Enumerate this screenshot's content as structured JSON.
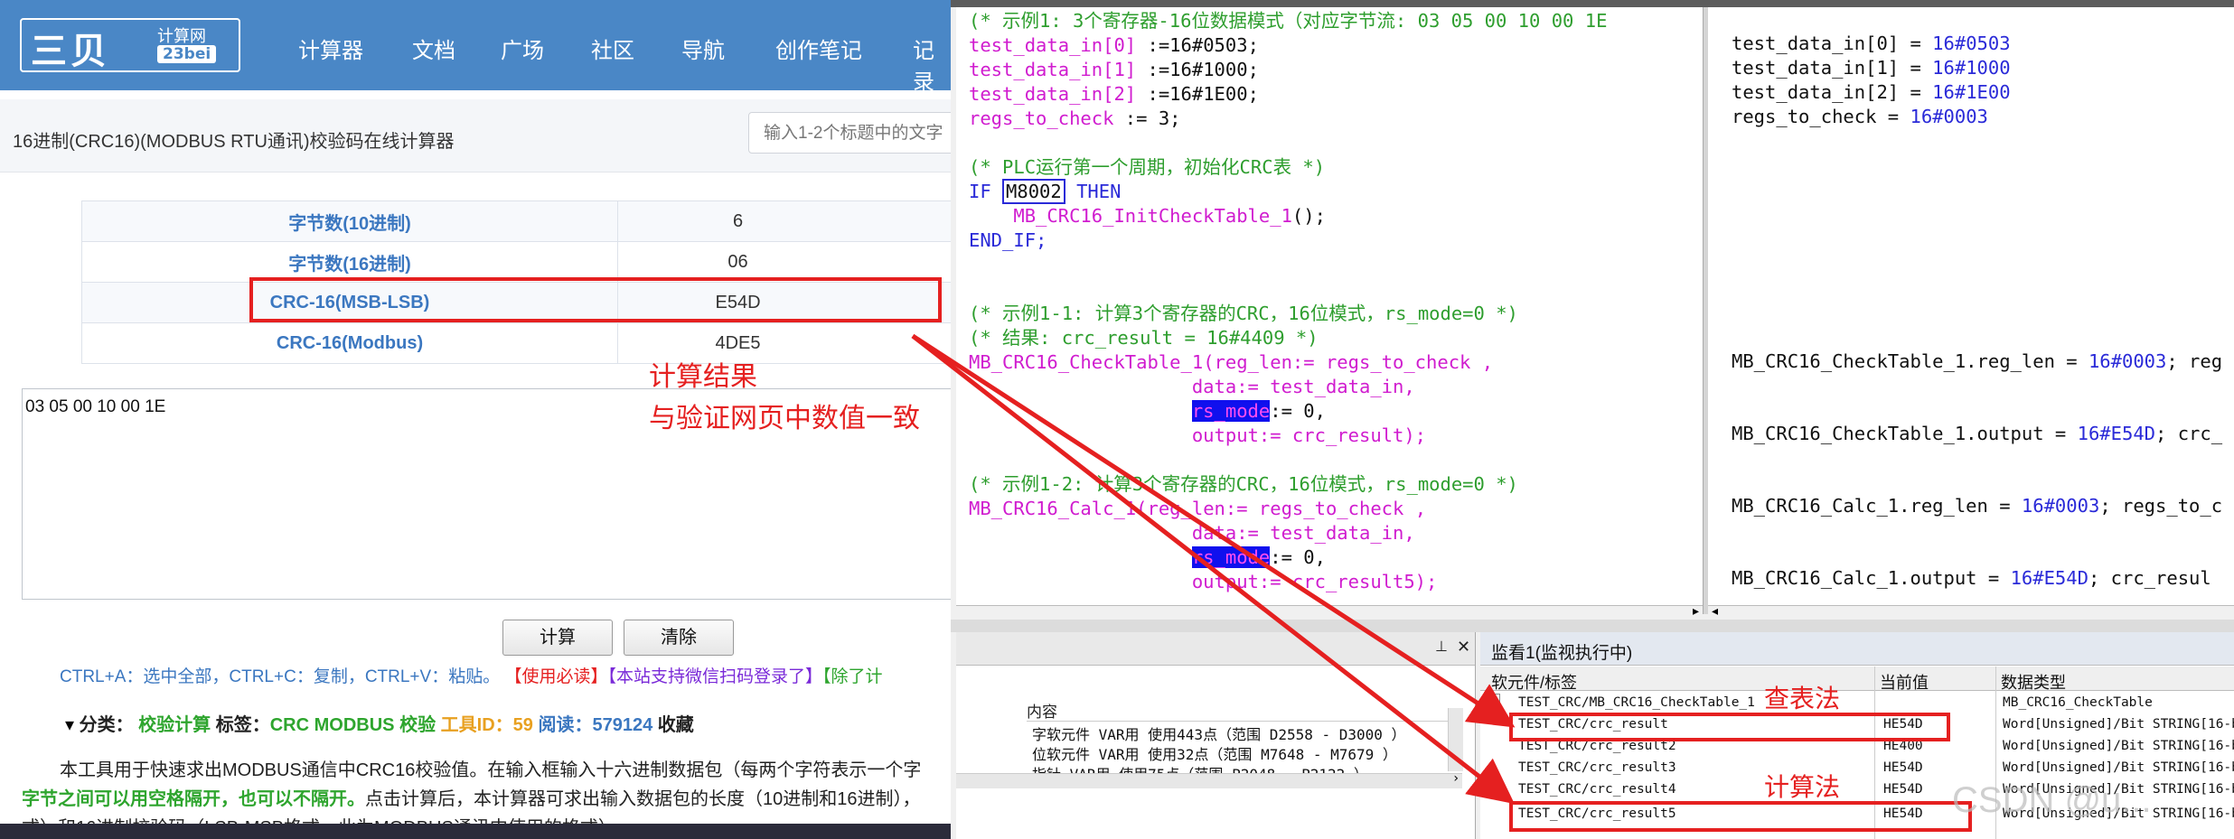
{
  "web": {
    "logo_big": "三贝",
    "logo_small": "计算网",
    "logo_domain": "23bei",
    "nav": [
      "计算器",
      "文档",
      "广场",
      "社区",
      "导航",
      "创作笔记",
      "记录"
    ],
    "page_title": "16进制(CRC16)(MODBUS RTU通讯)校验码在线计算器",
    "search_placeholder": "输入1-2个标题中的文字",
    "results": [
      {
        "label": "字节数(10进制)",
        "value": "6"
      },
      {
        "label": "字节数(16进制)",
        "value": "06"
      },
      {
        "label": "CRC-16(MSB-LSB)",
        "value": "E54D"
      },
      {
        "label": "CRC-16(Modbus)",
        "value": "4DE5"
      }
    ],
    "input_text": "03 05 00 10 00 1E",
    "annotation_line1": "计算结果",
    "annotation_line2": "与验证网页中数值一致",
    "calc_button": "计算",
    "clear_button": "清除",
    "shortcuts": {
      "plain": "CTRL+A：选中全部，CTRL+C：复制，CTRL+V：粘贴。",
      "notice": "【使用必读】",
      "wechat": "【本站支持微信扫码登录了】",
      "green": "【除了计"
    },
    "category": {
      "label": "分类：",
      "value": "校验计算",
      "tag_label": "标签：",
      "tag_value": "CRC MODBUS 校验",
      "tool_id_label": "工具ID：",
      "tool_id": "59",
      "reads_label": "阅读：",
      "reads": "579124",
      "collect": "收藏"
    },
    "desc_line1": "本工具用于快速求出MODBUS通信中CRC16校验值。在输入框输入十六进制数据包（每两个字符表示一个字",
    "desc_line2_green": "字节之间可以用空格隔开，也可以不隔开。",
    "desc_line2_rest": "点击计算后，本计算器可求出输入数据包的长度（10进制和16进制），",
    "desc_line3": "式）和16进制校验码（LSB-MSB格式，此为MODBUS通讯中使用的格式）"
  },
  "code": {
    "l1": "(* 示例1: 3个寄存器-16位数据模式（对应字节流: 03 05 00 10 00 1E",
    "l2_var": "test_data_in[0]",
    "l2_op": " :=",
    "l2_val": "16#0503",
    "l2_end": ";",
    "l3_var": "test_data_in[1]",
    "l3_op": " :=",
    "l3_val": "16#1000",
    "l3_end": ";",
    "l4_var": "test_data_in[2]",
    "l4_op": " :=",
    "l4_val": "16#1E00",
    "l4_end": ";",
    "l5_var": "regs_to_check",
    "l5_op": " :=",
    "l5_val": " 3",
    "l5_end": ";",
    "l6": "(* PLC运行第一个周期，初始化CRC表 *)",
    "l7_if": "IF ",
    "l7_m": "M8002",
    "l7_then": " THEN",
    "l8_fn": "    MB_CRC16_InitCheckTable_1",
    "l8_end": "();",
    "l9": "END_IF;",
    "l10": "(* 示例1-1: 计算3个寄存器的CRC，16位模式，rs_mode=0 *)",
    "l11": "(* 结果: crc_result = 16#4409 *)",
    "l12_fn": "MB_CRC16_CheckTable_1",
    "l12_rest": "(reg_len:= regs_to_check ,",
    "l13": "                    data:= test_data_in,",
    "l14_pre": "                    ",
    "l14_hl": "rs_mode",
    "l14_post": ":= 0,",
    "l15": "                    output:= crc_result);",
    "l16": "(* 示例1-2: 计算3个寄存器的CRC，16位模式，rs_mode=0 *)",
    "l17_fn": "MB_CRC16_Calc_1",
    "l17_rest": "(reg_len:= regs_to_check ,",
    "l18": "                    data:= test_data_in,",
    "l19_pre": "                    ",
    "l19_hl": "rs_mode",
    "l19_post": ":= 0,",
    "l20": "                    output:= crc_result5);"
  },
  "values": {
    "v1_k": "test_data_in[0] = ",
    "v1_n": "16#0503",
    "v2_k": "test_data_in[1] = ",
    "v2_n": "16#1000",
    "v3_k": "test_data_in[2] = ",
    "v3_n": "16#1E00",
    "v4_k": "regs_to_check = ",
    "v4_n": "16#0003",
    "v5_k": "MB_CRC16_CheckTable_1.reg_len = ",
    "v5_n": "16#0003",
    "v5_t": "; reg",
    "v6_k": "MB_CRC16_CheckTable_1.output = ",
    "v6_n": "16#E54D",
    "v6_t": "; crc_",
    "v7_k": "MB_CRC16_Calc_1.reg_len = ",
    "v7_n": "16#0003",
    "v7_t": "; regs_to_c",
    "v8_k": "MB_CRC16_Calc_1.output = ",
    "v8_n": "16#E54D",
    "v8_t": "; crc_resul"
  },
  "devices": {
    "header": "内容",
    "rows": [
      "字软元件 VAR用 使用443点（范围 D2558 - D3000 ）",
      "位软元件 VAR用 使用32点（范围 M7648 - M7679 ）",
      "指针 VAR用 使用75点（范围 P2048 - P2122 ）"
    ]
  },
  "watch": {
    "title": "监看1(监视执行中)",
    "col_label": "软元件/标签",
    "col_value": "当前值",
    "col_type": "数据类型",
    "rows": [
      {
        "label": "TEST_CRC/MB_CRC16_CheckTable_1",
        "value": "",
        "type": "MB_CRC16_CheckTable"
      },
      {
        "label": "TEST_CRC/crc_result",
        "value": "HE54D",
        "type": "Word[Unsigned]/Bit STRING[16-b"
      },
      {
        "label": "TEST_CRC/crc_result2",
        "value": "HE400",
        "type": "Word[Unsigned]/Bit STRING[16-b"
      },
      {
        "label": "TEST_CRC/crc_result3",
        "value": "HE54D",
        "type": "Word[Unsigned]/Bit STRING[16-b"
      },
      {
        "label": "TEST_CRC/crc_result4",
        "value": "HE54D",
        "type": "Word[Unsigned]/Bit STRING[16-b"
      },
      {
        "label": "TEST_CRC/crc_result5",
        "value": "HE54D",
        "type": "Word[Unsigned]/Bit STRING[16-b"
      }
    ],
    "label_table": "查表法",
    "label_calc": "计算法",
    "watermark": "CSDN @u..."
  },
  "colors": {
    "accent_blue": "#4a87c6",
    "annotation_red": "#e52020",
    "comment_green": "#2e9e2e",
    "keyword_blue": "#2a2ad8",
    "function_magenta": "#d01ccf"
  }
}
